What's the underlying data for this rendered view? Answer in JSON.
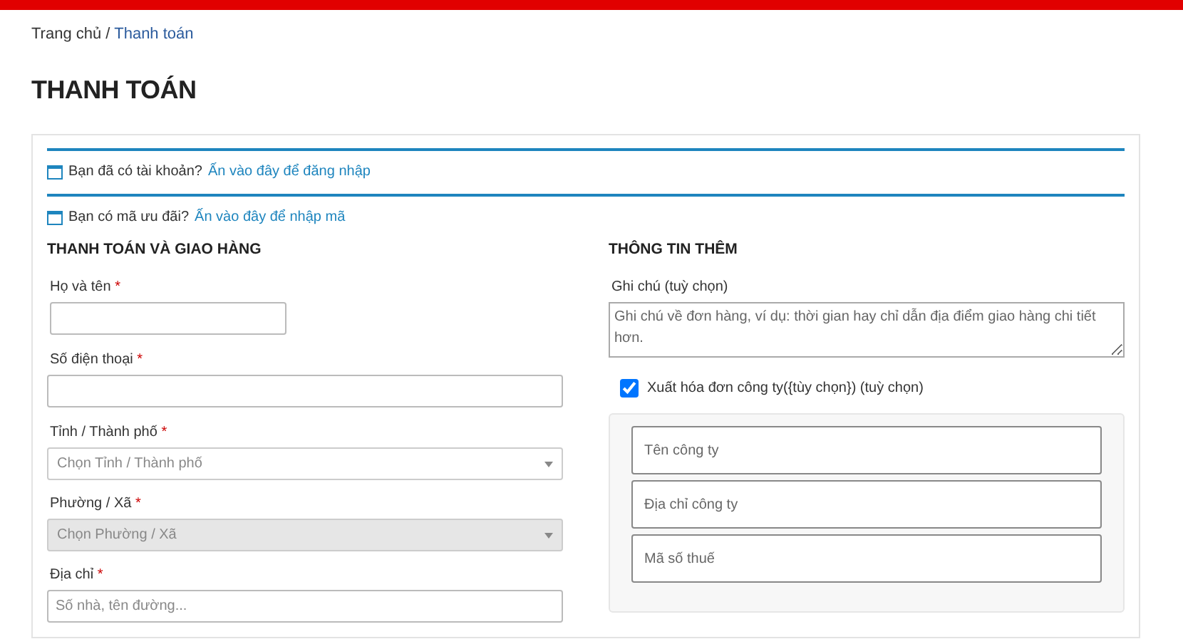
{
  "breadcrumb": {
    "items": [
      {
        "label": "Trang chủ",
        "kind": "text"
      },
      {
        "label": "Thanh toán",
        "kind": "link"
      }
    ],
    "separator": "/"
  },
  "page_title": "THANH TOÁN",
  "notices": [
    {
      "text": "Bạn đã có tài khoản?",
      "link": "Ấn vào đây để đăng nhập"
    },
    {
      "text": "Bạn có mã ưu đãi?",
      "link": "Ấn vào đây để nhập mã"
    }
  ],
  "billing": {
    "title": "THANH TOÁN VÀ GIAO HÀNG",
    "fields": [
      {
        "label": "Họ và tên",
        "required_mark": "*",
        "kind": "short-input"
      },
      {
        "label": "Số điện thoại",
        "required_mark": "*",
        "kind": "input"
      },
      {
        "label": "Tỉnh / Thành phố",
        "required_mark": "*",
        "kind": "select",
        "placeholder": "Chọn Tỉnh / Thành phố",
        "disabled": false
      },
      {
        "label": "Phường / Xã",
        "required_mark": "*",
        "kind": "select",
        "placeholder": "Chọn Phường / Xã",
        "disabled": true
      },
      {
        "label": "Địa chỉ",
        "required_mark": "*",
        "kind": "input",
        "placeholder": "Số nhà, tên đường..."
      }
    ]
  },
  "additional": {
    "title": "THÔNG TIN THÊM",
    "note": {
      "label": "Ghi chú (tuỳ chọn)",
      "placeholder": "Ghi chú về đơn hàng, ví dụ: thời gian hay chỉ dẫn địa điểm giao hàng chi tiết hơn."
    },
    "invoice": {
      "label": "Xuất hóa đơn công ty({tùy chọn}) (tuỳ chọn)",
      "checked": true
    },
    "company_fields": [
      {
        "placeholder": "Tên công ty"
      },
      {
        "placeholder": "Địa chỉ công ty"
      },
      {
        "placeholder": "Mã số thuế"
      }
    ]
  }
}
